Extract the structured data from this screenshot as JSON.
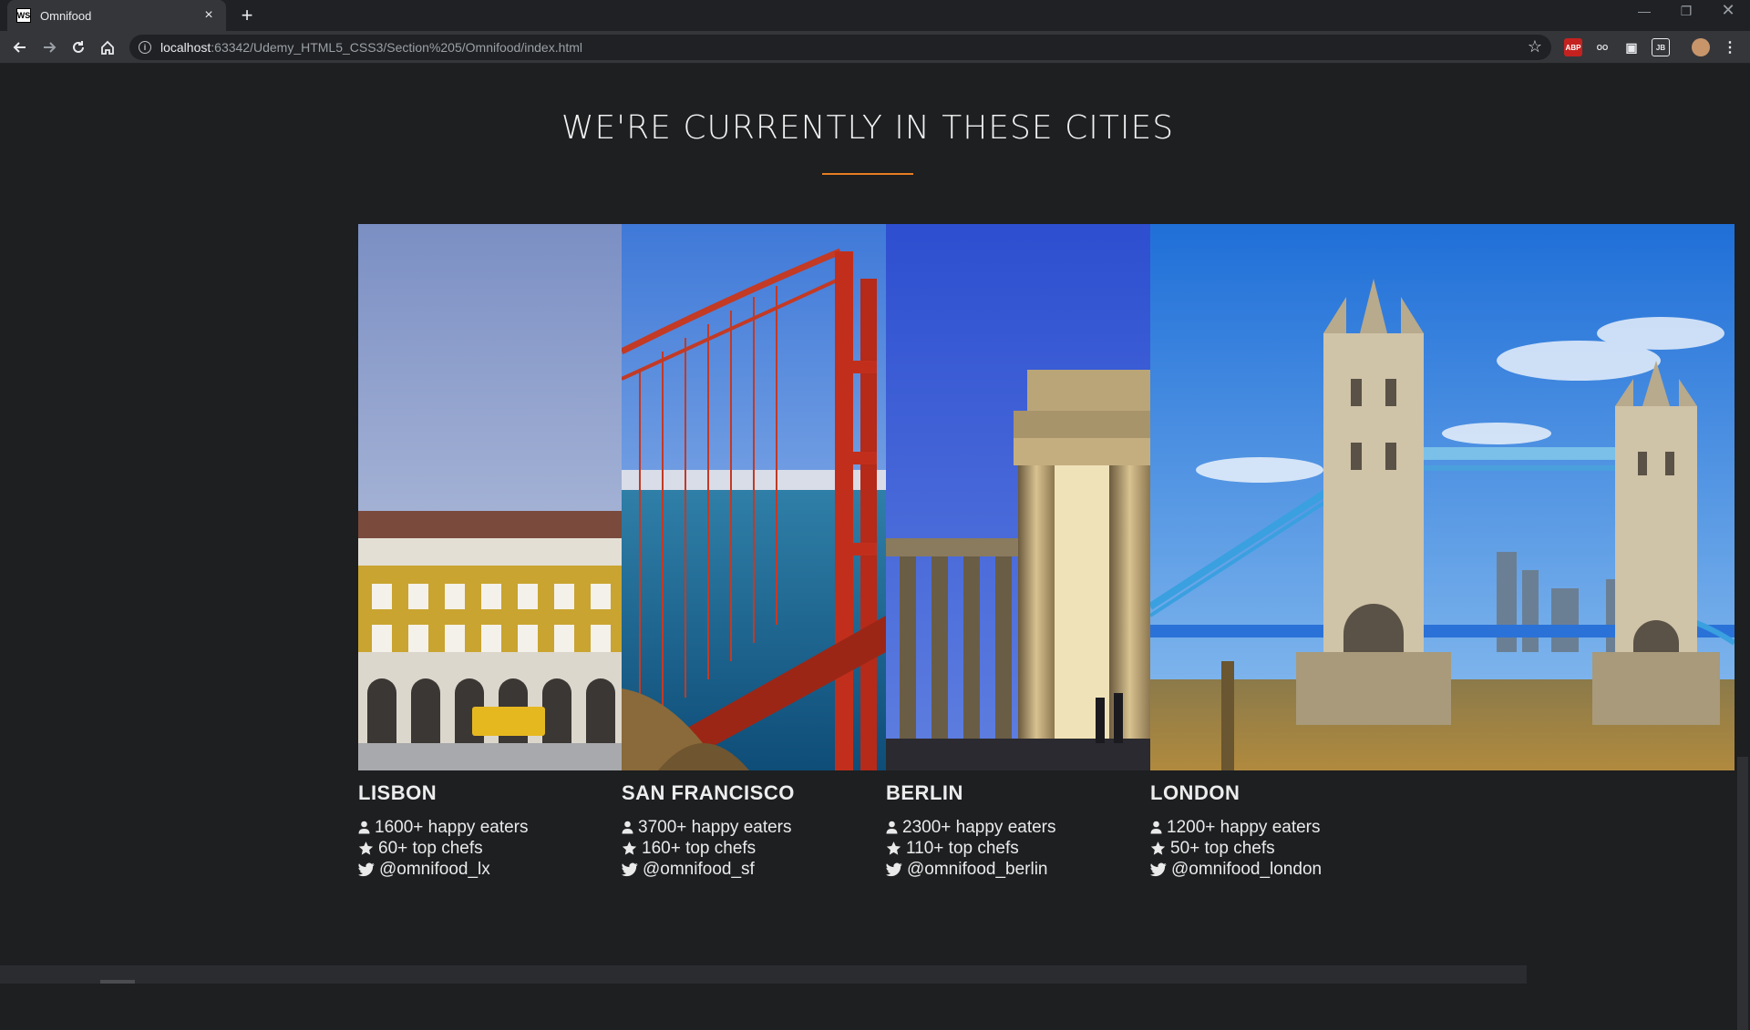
{
  "browser": {
    "tab_title": "Omnifood",
    "tab_favicon": "WS",
    "url_host": "localhost",
    "url_rest": ":63342/Udemy_HTML5_CSS3/Section%205/Omnifood/index.html",
    "extensions": [
      "ABP",
      "OO",
      "▣",
      "JB"
    ]
  },
  "section": {
    "title": "WE'RE CURRENTLY IN THESE CITIES",
    "accent_color": "#e67e22"
  },
  "cities": [
    {
      "name": "LISBON",
      "eaters": "1600+ happy eaters",
      "chefs": "60+ top chefs",
      "twitter": "@omnifood_lx"
    },
    {
      "name": "SAN FRANCISCO",
      "eaters": "3700+ happy eaters",
      "chefs": "160+ top chefs",
      "twitter": "@omnifood_sf"
    },
    {
      "name": "BERLIN",
      "eaters": "2300+ happy eaters",
      "chefs": "110+ top chefs",
      "twitter": "@omnifood_berlin"
    },
    {
      "name": "LONDON",
      "eaters": "1200+ happy eaters",
      "chefs": "50+ top chefs",
      "twitter": "@omnifood_london"
    }
  ]
}
